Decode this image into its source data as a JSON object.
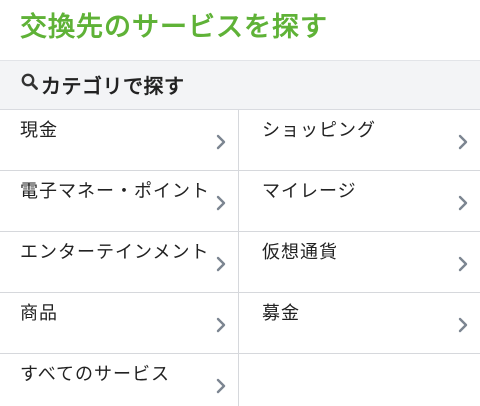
{
  "page": {
    "title": "交換先のサービスを探す"
  },
  "section": {
    "label": "カテゴリで探す",
    "icon": "search-icon"
  },
  "categories": [
    {
      "label": "現金"
    },
    {
      "label": "ショッピング"
    },
    {
      "label": "電子マネー・ポイント"
    },
    {
      "label": "マイレージ"
    },
    {
      "label": "エンターテインメント"
    },
    {
      "label": "仮想通貨"
    },
    {
      "label": "商品"
    },
    {
      "label": "募金"
    },
    {
      "label": "すべてのサービス"
    }
  ],
  "colors": {
    "title": "#5fb237",
    "header_bg": "#f3f4f6",
    "divider": "#d6d8dc",
    "chevron": "#7c8591"
  }
}
